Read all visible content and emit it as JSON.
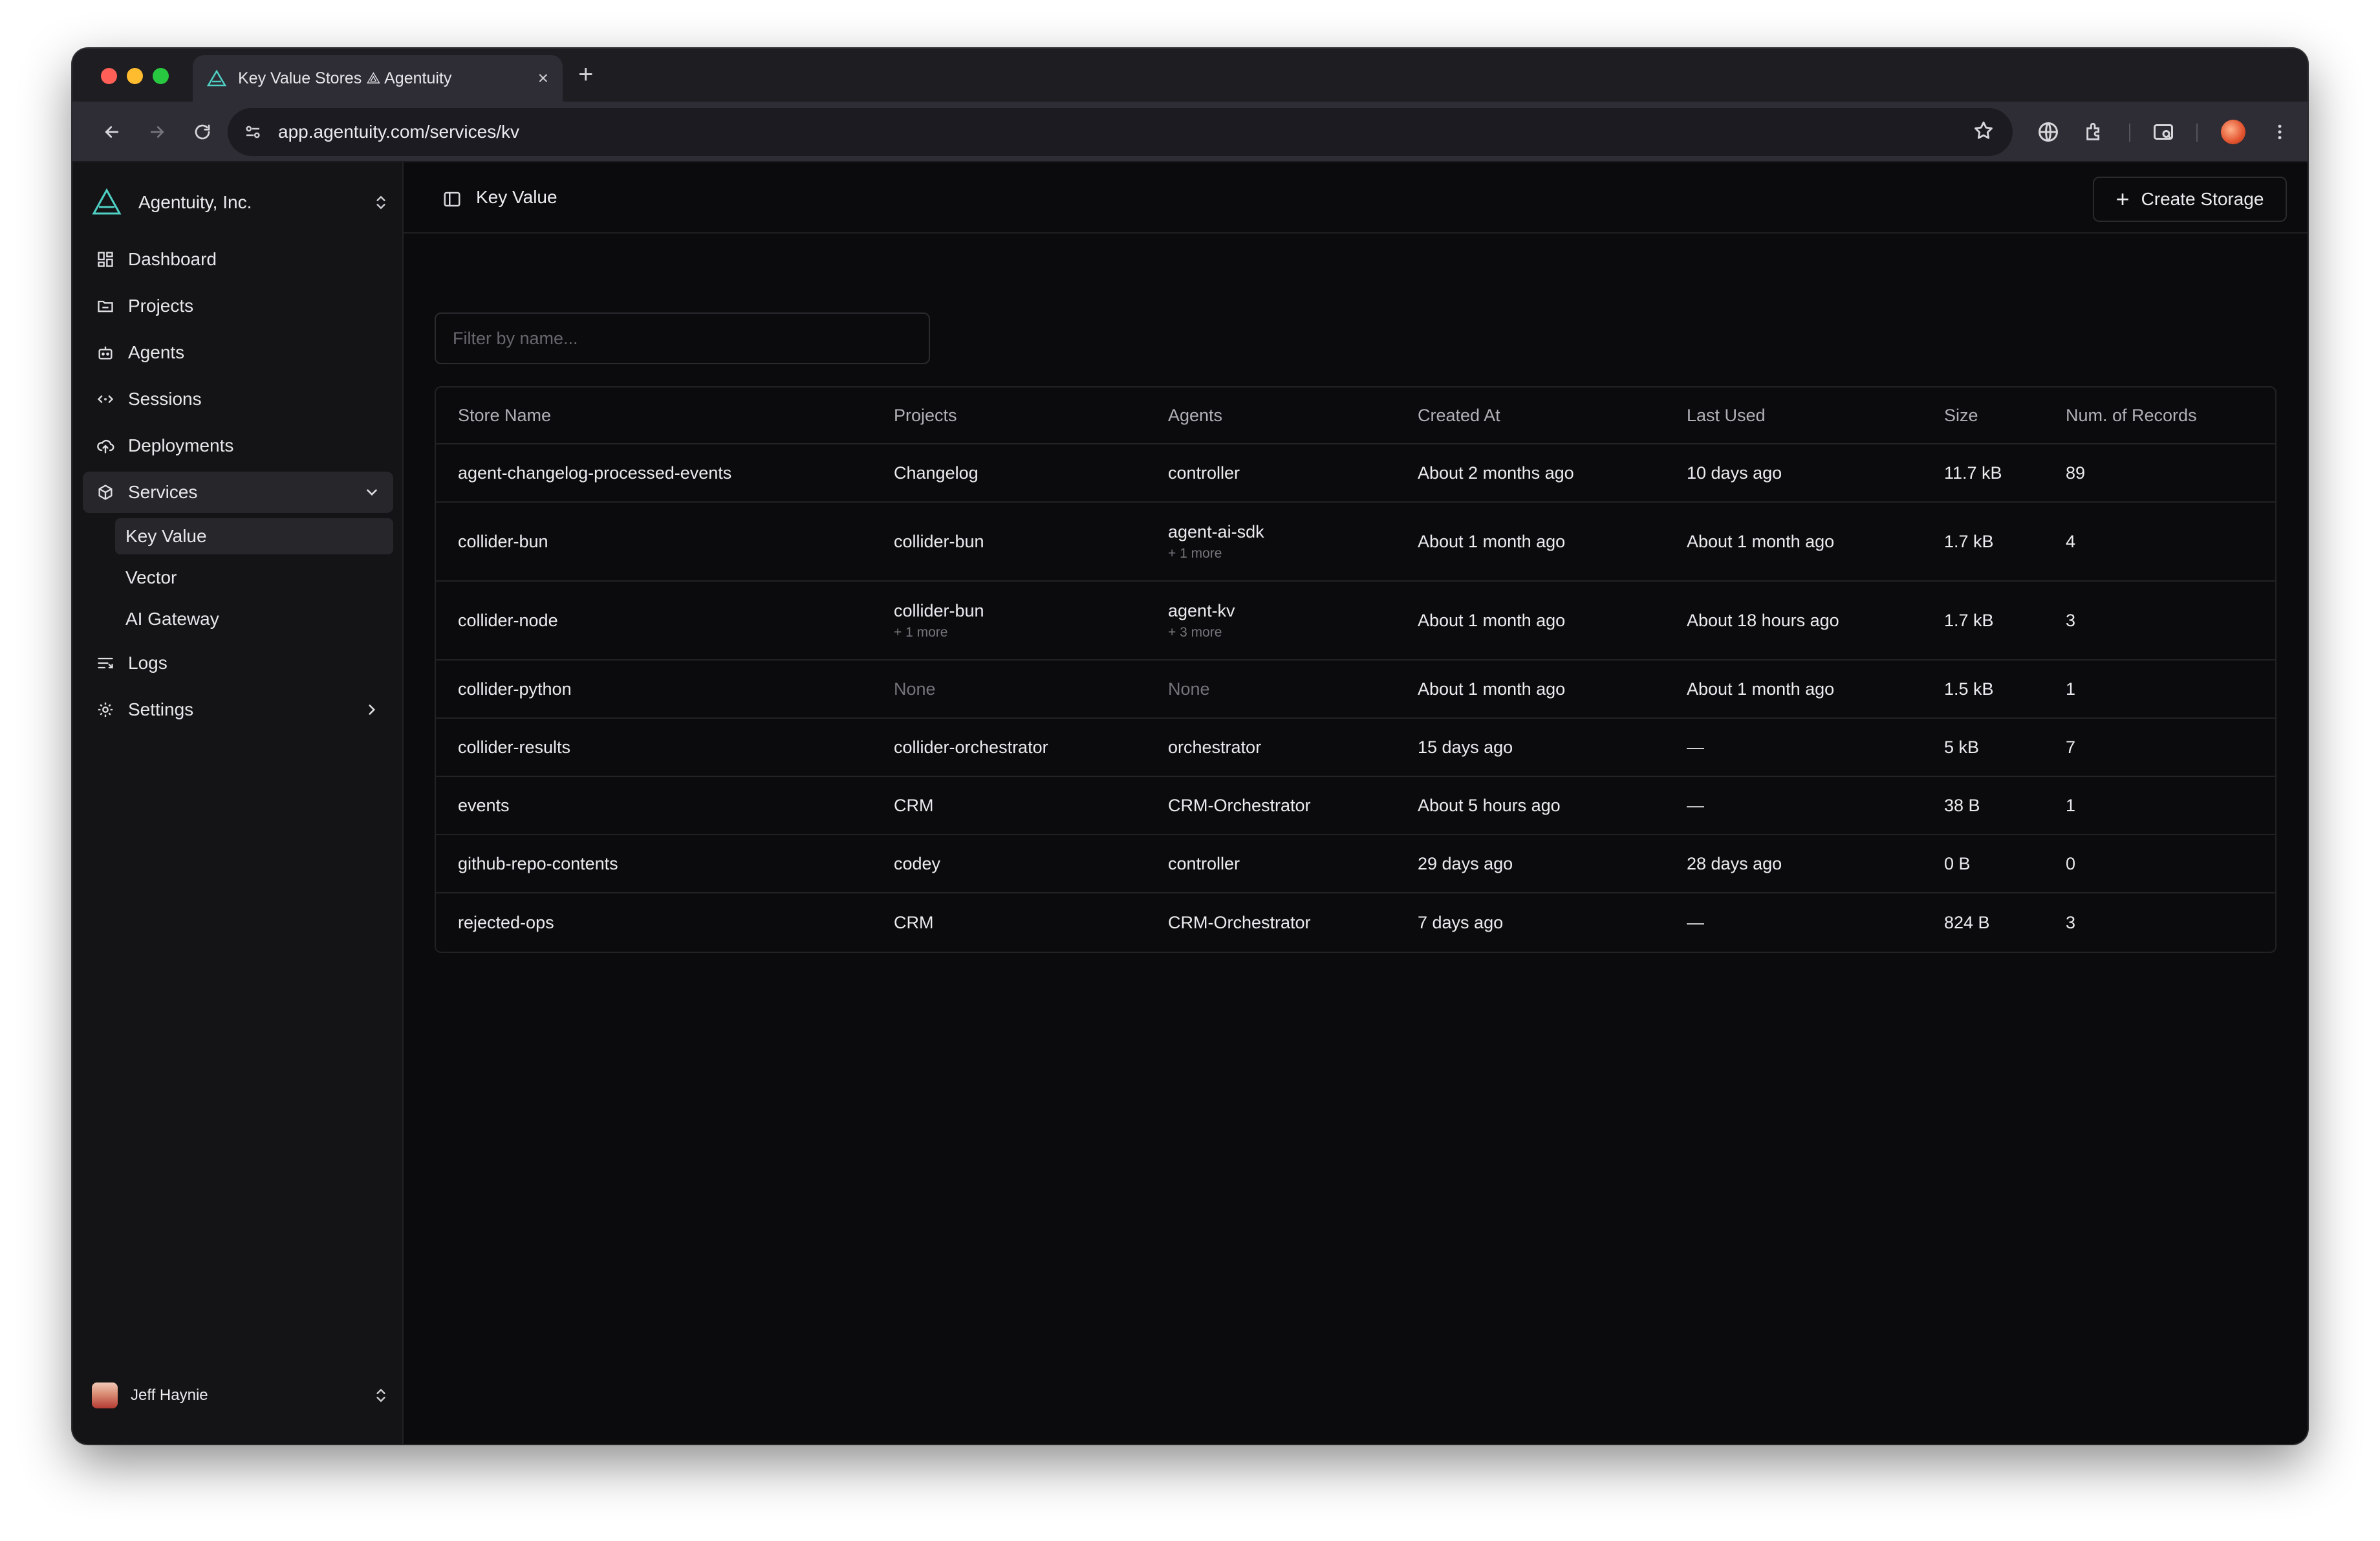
{
  "browser": {
    "tab_title": "Key Value Stores ⟁ Agentuity",
    "tab_close": "×",
    "new_tab": "+",
    "url": "app.agentuity.com/services/kv"
  },
  "sidebar": {
    "org_name": "Agentuity, Inc.",
    "nav": [
      {
        "label": "Dashboard",
        "icon": "dashboard-icon"
      },
      {
        "label": "Projects",
        "icon": "folder-icon"
      },
      {
        "label": "Agents",
        "icon": "bot-icon"
      },
      {
        "label": "Sessions",
        "icon": "code-arrows-icon"
      },
      {
        "label": "Deployments",
        "icon": "cloud-upload-icon"
      },
      {
        "label": "Services",
        "icon": "box-icon"
      },
      {
        "label": "Logs",
        "icon": "logs-icon"
      },
      {
        "label": "Settings",
        "icon": "gear-icon"
      }
    ],
    "services_sub": [
      "Key Value",
      "Vector",
      "AI Gateway"
    ],
    "user_name": "Jeff Haynie"
  },
  "main": {
    "title": "Key Value",
    "create_button": "Create Storage",
    "filter_placeholder": "Filter by name..."
  },
  "table": {
    "columns": [
      "Store Name",
      "Projects",
      "Agents",
      "Created At",
      "Last Used",
      "Size",
      "Num. of Records"
    ],
    "rows": [
      {
        "name": "agent-changelog-processed-events",
        "project": "Changelog",
        "project_more": "",
        "agent": "controller",
        "agent_more": "",
        "created": "About 2 months ago",
        "last_used": "10 days ago",
        "size": "11.7 kB",
        "records": "89"
      },
      {
        "name": "collider-bun",
        "project": "collider-bun",
        "project_more": "",
        "agent": "agent-ai-sdk",
        "agent_more": "+ 1 more",
        "created": "About 1 month ago",
        "last_used": "About 1 month ago",
        "size": "1.7 kB",
        "records": "4"
      },
      {
        "name": "collider-node",
        "project": "collider-bun",
        "project_more": "+ 1 more",
        "agent": "agent-kv",
        "agent_more": "+ 3 more",
        "created": "About 1 month ago",
        "last_used": "About 18 hours ago",
        "size": "1.7 kB",
        "records": "3"
      },
      {
        "name": "collider-python",
        "project": "None",
        "project_more": "",
        "agent": "None",
        "agent_more": "",
        "created": "About 1 month ago",
        "last_used": "About 1 month ago",
        "size": "1.5 kB",
        "records": "1"
      },
      {
        "name": "collider-results",
        "project": "collider-orchestrator",
        "project_more": "",
        "agent": "orchestrator",
        "agent_more": "",
        "created": "15 days ago",
        "last_used": "—",
        "size": "5 kB",
        "records": "7"
      },
      {
        "name": "events",
        "project": "CRM",
        "project_more": "",
        "agent": "CRM-Orchestrator",
        "agent_more": "",
        "created": "About 5 hours ago",
        "last_used": "—",
        "size": "38 B",
        "records": "1"
      },
      {
        "name": "github-repo-contents",
        "project": "codey",
        "project_more": "",
        "agent": "controller",
        "agent_more": "",
        "created": "29 days ago",
        "last_used": "28 days ago",
        "size": "0 B",
        "records": "0"
      },
      {
        "name": "rejected-ops",
        "project": "CRM",
        "project_more": "",
        "agent": "CRM-Orchestrator",
        "agent_more": "",
        "created": "7 days ago",
        "last_used": "—",
        "size": "824 B",
        "records": "3"
      }
    ]
  }
}
